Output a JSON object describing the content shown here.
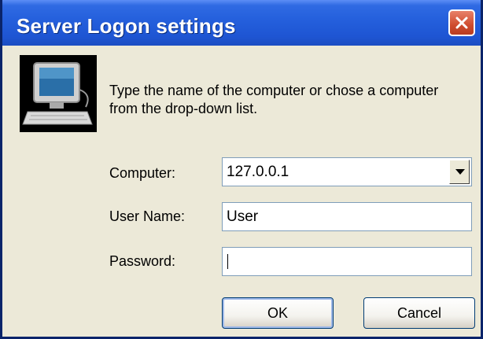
{
  "window": {
    "title": "Server Logon settings",
    "icon": "computer-icon",
    "close_icon": "close-icon"
  },
  "instructions": "Type the name of the computer or chose a computer from the drop-down list.",
  "form": {
    "computer_label": "Computer:",
    "computer_value": "127.0.0.1",
    "username_label": "User Name:",
    "username_value": "User",
    "password_label": "Password:",
    "password_value": ""
  },
  "buttons": {
    "ok": "OK",
    "cancel": "Cancel"
  },
  "colors": {
    "titlebar": "#245fdc",
    "close_button": "#cf4b2e",
    "dialog_background": "#ece9d8"
  }
}
